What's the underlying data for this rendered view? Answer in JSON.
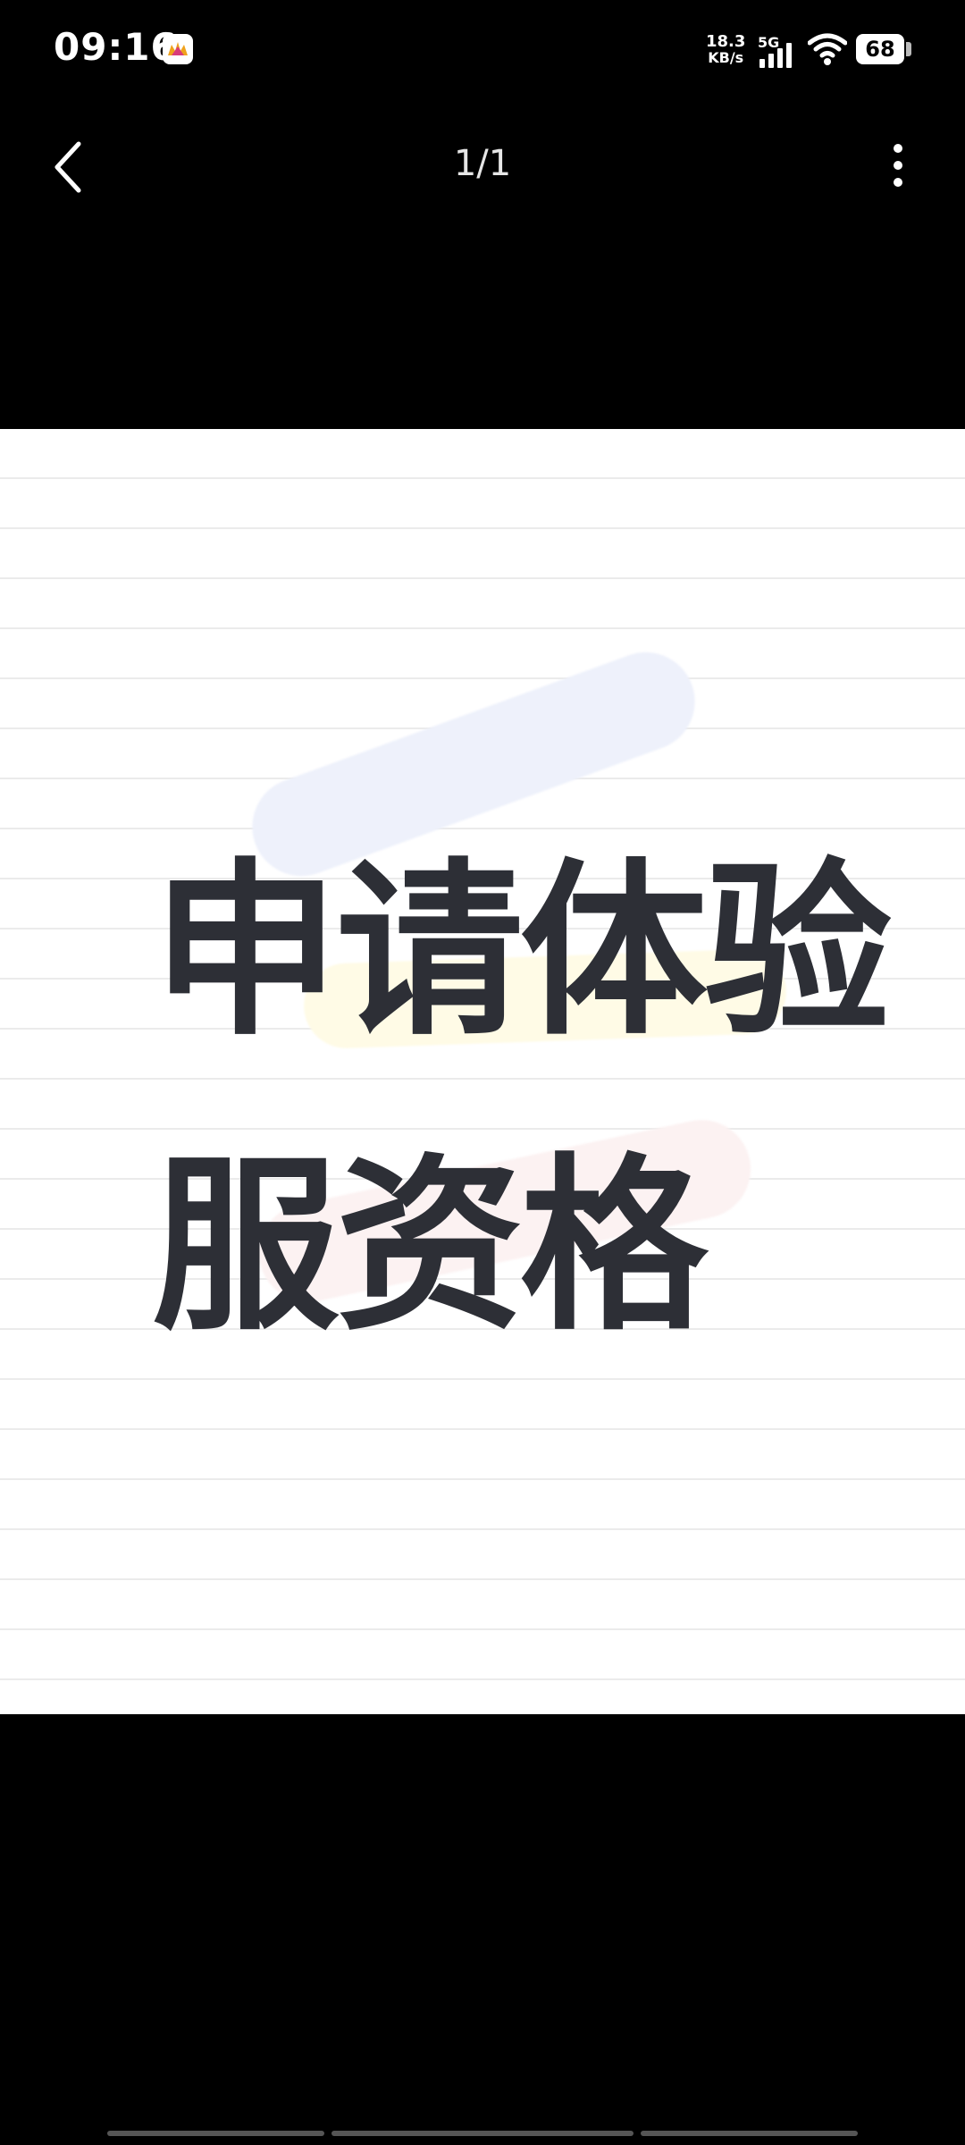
{
  "status_bar": {
    "time": "09:16",
    "net_speed": "18.3",
    "net_unit": "KB/s",
    "network_type": "5G",
    "battery": "68",
    "icons": [
      "app-badge-icon",
      "signal-icon",
      "wifi-icon",
      "battery-icon"
    ]
  },
  "nav": {
    "page_indicator": "1/1",
    "icons": [
      "back-chevron-icon",
      "more-vertical-icon"
    ]
  },
  "content": {
    "headline_line1": "申请体验",
    "headline_line2": "服资格",
    "highlight_colors": [
      "#eef1fb",
      "#fffbe6",
      "#fcf2f2"
    ],
    "text_color": "#2d2f36"
  }
}
